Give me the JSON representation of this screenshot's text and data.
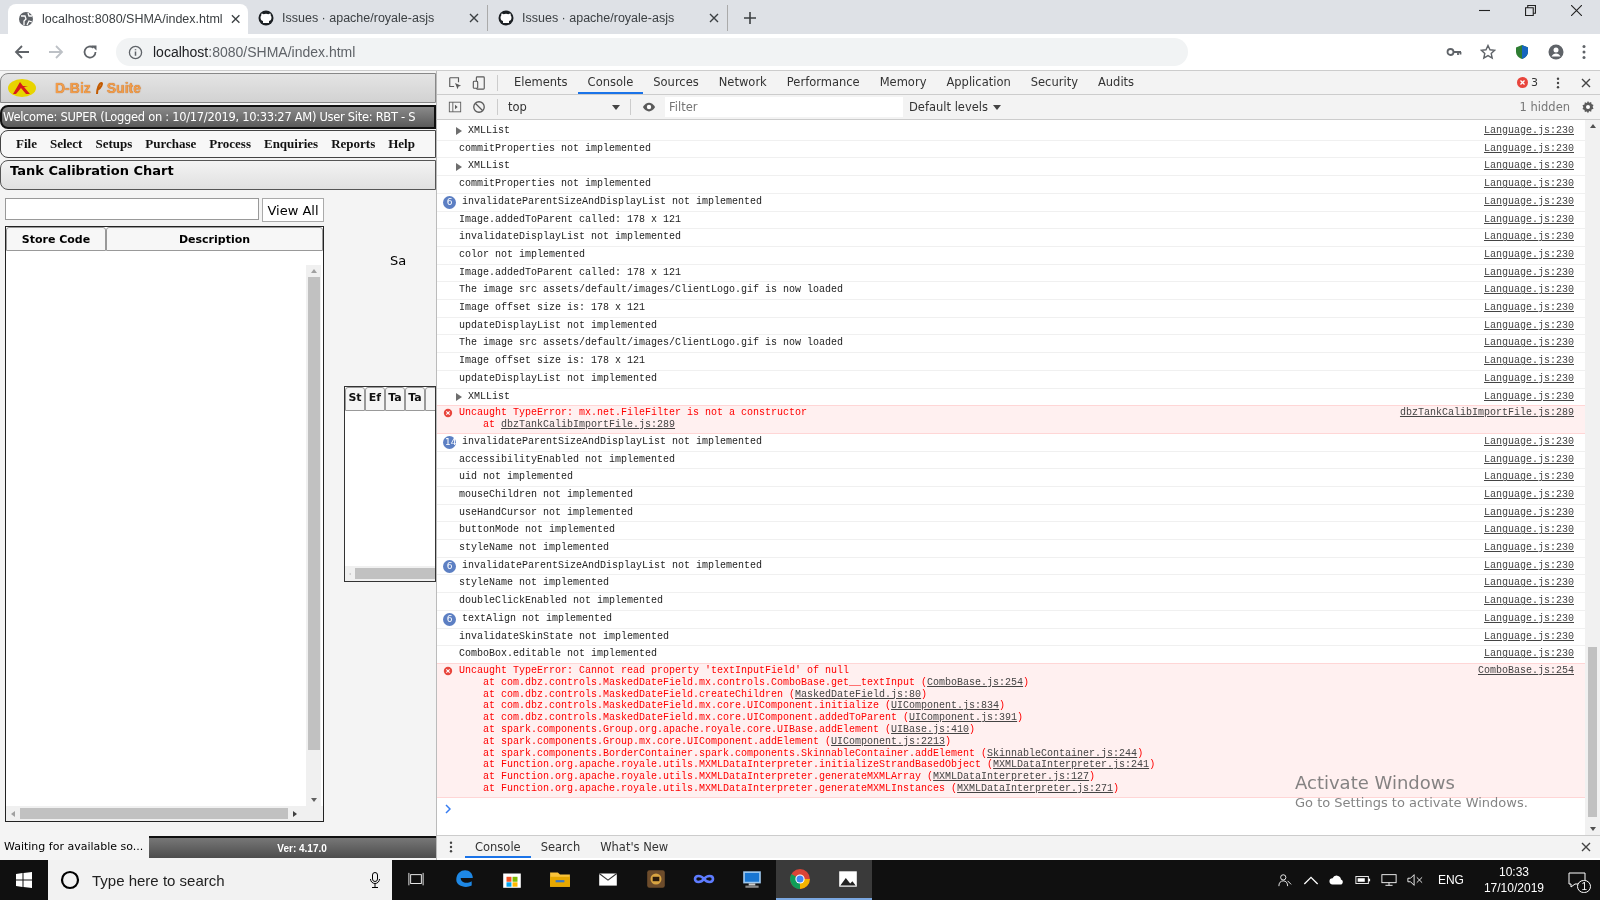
{
  "browser": {
    "tabs": [
      {
        "title": "localhost:8080/SHMA/index.html",
        "selected": true
      },
      {
        "title": "Issues · apache/royale-asjs",
        "selected": false
      },
      {
        "title": "Issues · apache/royale-asjs",
        "selected": false
      }
    ],
    "url": {
      "host": "localhost",
      "rest": ":8080/SHMA/index.html"
    },
    "forward_disabled": true
  },
  "app": {
    "brand_left": "D-Biz",
    "brand_right": "Suite",
    "welcome": "Welcome: SUPER (Logged on : 10/17/2019, 10:33:27 AM) User Site: RBT - S",
    "menu": [
      "File",
      "Select",
      "Setups",
      "Purchase",
      "Process",
      "Enquiries",
      "Reports",
      "Help"
    ],
    "title": "Tank Calibration Chart",
    "view_all": "View All",
    "columns": [
      "Store Code",
      "Description"
    ],
    "side_label": "Sa",
    "grid_columns": [
      "St",
      "Ef",
      "Ta",
      "Ta"
    ],
    "status": "Waiting for available so...",
    "version": "Ver: 4.17.0"
  },
  "devtools": {
    "tabs": [
      {
        "label": "Elements",
        "selected": false
      },
      {
        "label": "Console",
        "selected": true
      },
      {
        "label": "Sources",
        "selected": false
      },
      {
        "label": "Network",
        "selected": false
      },
      {
        "label": "Performance",
        "selected": false
      },
      {
        "label": "Memory",
        "selected": false
      },
      {
        "label": "Application",
        "selected": false
      },
      {
        "label": "Security",
        "selected": false
      },
      {
        "label": "Audits",
        "selected": false
      }
    ],
    "error_count": "3",
    "context": "top",
    "filter_placeholder": "Filter",
    "levels": "Default levels",
    "hidden": "1 hidden",
    "messages": [
      {
        "kind": "group",
        "text": "XMLList",
        "expanded": false,
        "source": "Language.js:230"
      },
      {
        "kind": "log",
        "text": "commitProperties not implemented",
        "source": "Language.js:230"
      },
      {
        "kind": "group",
        "text": "XMLList",
        "expanded": false,
        "source": "Language.js:230"
      },
      {
        "kind": "log",
        "text": "commitProperties not implemented",
        "source": "Language.js:230"
      },
      {
        "kind": "count",
        "count": "6",
        "text": "invalidateParentSizeAndDisplayList not implemented",
        "source": "Language.js:230"
      },
      {
        "kind": "log",
        "text": "Image.addedToParent called: 178 x 121",
        "source": "Language.js:230"
      },
      {
        "kind": "log",
        "text": "invalidateDisplayList not implemented",
        "source": "Language.js:230"
      },
      {
        "kind": "log",
        "text": "color not implemented",
        "source": "Language.js:230"
      },
      {
        "kind": "log",
        "text": "Image.addedToParent called: 178 x 121",
        "source": "Language.js:230"
      },
      {
        "kind": "log",
        "text": "The image src assets/default/images/ClientLogo.gif is now loaded",
        "source": "Language.js:230"
      },
      {
        "kind": "log",
        "text": "Image offset size is: 178 x 121",
        "source": "Language.js:230"
      },
      {
        "kind": "log",
        "text": "updateDisplayList not implemented",
        "source": "Language.js:230"
      },
      {
        "kind": "log",
        "text": "The image src assets/default/images/ClientLogo.gif is now loaded",
        "source": "Language.js:230"
      },
      {
        "kind": "log",
        "text": "Image offset size is: 178 x 121",
        "source": "Language.js:230"
      },
      {
        "kind": "log",
        "text": "updateDisplayList not implemented",
        "source": "Language.js:230"
      },
      {
        "kind": "group",
        "text": "XMLList",
        "expanded": false,
        "source": "Language.js:230"
      },
      {
        "kind": "error",
        "text": "Uncaught TypeError: mx.net.FileFilter is not a constructor",
        "source": "dbzTankCalibImportFile.js:289",
        "stack": [
          {
            "text": "at ",
            "link": "dbzTankCalibImportFile.js:289"
          }
        ]
      },
      {
        "kind": "count",
        "count": "14",
        "text": "invalidateParentSizeAndDisplayList not implemented",
        "source": "Language.js:230"
      },
      {
        "kind": "log",
        "text": "accessibilityEnabled not implemented",
        "source": "Language.js:230"
      },
      {
        "kind": "log",
        "text": "uid not implemented",
        "source": "Language.js:230"
      },
      {
        "kind": "log",
        "text": "mouseChildren not implemented",
        "source": "Language.js:230"
      },
      {
        "kind": "log",
        "text": "useHandCursor not implemented",
        "source": "Language.js:230"
      },
      {
        "kind": "log",
        "text": "buttonMode not implemented",
        "source": "Language.js:230"
      },
      {
        "kind": "log",
        "text": "styleName not implemented",
        "source": "Language.js:230"
      },
      {
        "kind": "count",
        "count": "6",
        "text": "invalidateParentSizeAndDisplayList not implemented",
        "source": "Language.js:230"
      },
      {
        "kind": "log",
        "text": "styleName not implemented",
        "source": "Language.js:230"
      },
      {
        "kind": "log",
        "text": "doubleClickEnabled not implemented",
        "source": "Language.js:230"
      },
      {
        "kind": "count",
        "count": "6",
        "text": "textAlign not implemented",
        "source": "Language.js:230"
      },
      {
        "kind": "log",
        "text": "invalidateSkinState not implemented",
        "source": "Language.js:230"
      },
      {
        "kind": "log",
        "text": "ComboBox.editable not implemented",
        "source": "Language.js:230"
      },
      {
        "kind": "error",
        "text": "Uncaught TypeError: Cannot read property 'textInputField' of null",
        "source": "ComboBase.js:254",
        "stack": [
          {
            "text": "at com.dbz.controls.MaskedDateField.mx.controls.ComboBase.get__textInput (",
            "link": "ComboBase.js:254",
            "after": ")"
          },
          {
            "text": "at com.dbz.controls.MaskedDateField.createChildren (",
            "link": "MaskedDateField.js:80",
            "after": ")"
          },
          {
            "text": "at com.dbz.controls.MaskedDateField.mx.core.UIComponent.initialize (",
            "link": "UIComponent.js:834",
            "after": ")"
          },
          {
            "text": "at com.dbz.controls.MaskedDateField.mx.core.UIComponent.addedToParent (",
            "link": "UIComponent.js:391",
            "after": ")"
          },
          {
            "text": "at spark.components.Group.org.apache.royale.core.UIBase.addElement (",
            "link": "UIBase.js:410",
            "after": ")"
          },
          {
            "text": "at spark.components.Group.mx.core.UIComponent.addElement (",
            "link": "UIComponent.js:2213",
            "after": ")"
          },
          {
            "text": "at spark.components.BorderContainer.spark.components.SkinnableContainer.addElement (",
            "link": "SkinnableContainer.js:244",
            "after": ")"
          },
          {
            "text": "at Function.org.apache.royale.utils.MXMLDataInterpreter.initializeStrandBasedObject (",
            "link": "MXMLDataInterpreter.js:241",
            "after": ")"
          },
          {
            "text": "at Function.org.apache.royale.utils.MXMLDataInterpreter.generateMXMLArray (",
            "link": "MXMLDataInterpreter.js:127",
            "after": ")"
          },
          {
            "text": "at Function.org.apache.royale.utils.MXMLDataInterpreter.generateMXMLInstances (",
            "link": "MXMLDataInterpreter.js:271",
            "after": ")"
          }
        ]
      }
    ],
    "drawer_tabs": [
      {
        "label": "Console",
        "selected": true
      },
      {
        "label": "Search",
        "selected": false
      },
      {
        "label": "What's New",
        "selected": false
      }
    ]
  },
  "activation": {
    "title": "Activate Windows",
    "hint": "Go to Settings to activate Windows."
  },
  "taskbar": {
    "search_placeholder": "Type here to search",
    "apps": [
      {
        "kind": "edge",
        "active": false
      },
      {
        "kind": "store",
        "active": false
      },
      {
        "kind": "folder",
        "active": false
      },
      {
        "kind": "mail",
        "active": false
      },
      {
        "kind": "game",
        "active": false
      },
      {
        "kind": "loop",
        "active": false
      },
      {
        "kind": "remote",
        "active": false
      },
      {
        "kind": "chrome",
        "active": true
      },
      {
        "kind": "photos",
        "active": true
      }
    ],
    "language": "ENG",
    "time": "10:33",
    "date": "17/10/2019",
    "notifications": "1"
  }
}
